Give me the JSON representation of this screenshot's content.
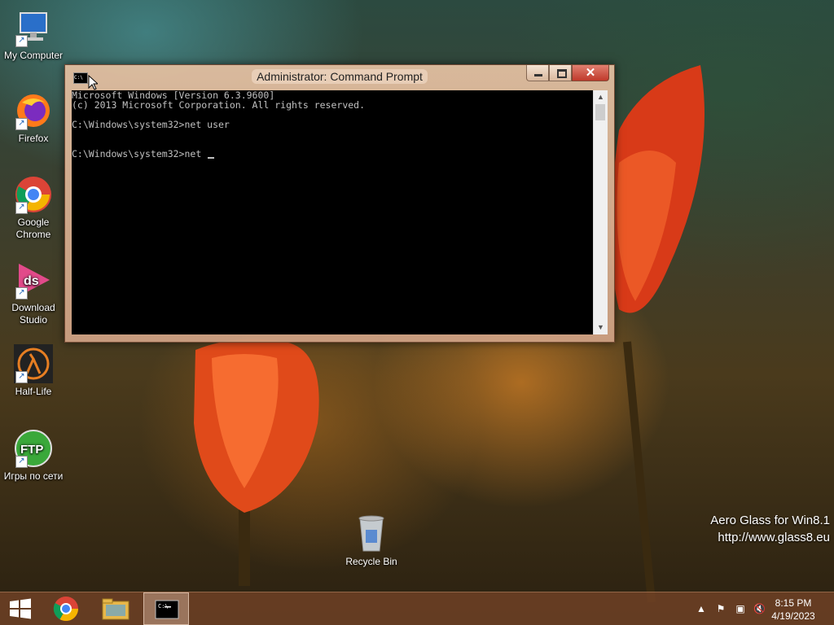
{
  "desktop": {
    "icons": [
      {
        "label": "My Computer"
      },
      {
        "label": "Firefox"
      },
      {
        "label": "Google Chrome"
      },
      {
        "label": "Download Studio"
      },
      {
        "label": "Half-Life"
      },
      {
        "label": "Игры по сети"
      }
    ],
    "recycle_bin": {
      "label": "Recycle Bin"
    },
    "watermark": {
      "line1": "Aero Glass for Win8.1",
      "line2": "http://www.glass8.eu"
    }
  },
  "window": {
    "title": "Administrator:  Command Prompt",
    "console_lines": [
      "Microsoft Windows [Version 6.3.9600]",
      "(c) 2013 Microsoft Corporation. All rights reserved.",
      "",
      "C:\\Windows\\system32>net user",
      "",
      "",
      "C:\\Windows\\system32>net "
    ],
    "close_glyph": "✕"
  },
  "taskbar": {
    "pinned": [
      "start-button",
      "chrome",
      "file-explorer",
      "command-prompt"
    ],
    "clock_time": "8:15 PM",
    "clock_date": "4/19/2023"
  },
  "colors": {
    "console_bg": "#000000",
    "console_fg": "#c0c0c0",
    "close_button": "#c0392b"
  }
}
